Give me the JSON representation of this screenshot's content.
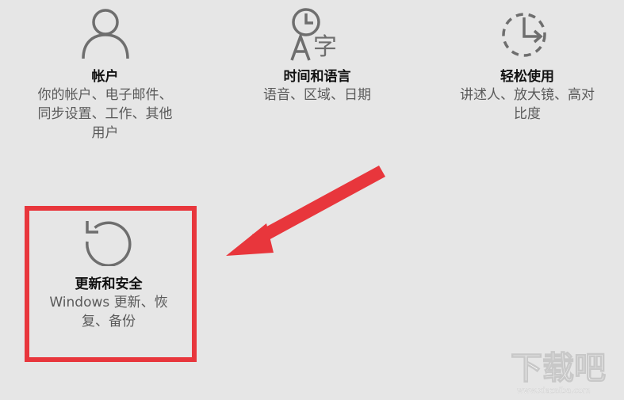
{
  "tiles": {
    "accounts": {
      "icon": "person-icon",
      "title": "帐户",
      "desc_lines": [
        "你的帐户、电子邮件、",
        "同步设置、工作、其他",
        "用户"
      ]
    },
    "time_language": {
      "icon": "time-language-icon",
      "title": "时间和语言",
      "desc_lines": [
        "语音、区域、日期"
      ]
    },
    "ease_of_access": {
      "icon": "ease-of-access-icon",
      "title": "轻松使用",
      "desc_lines": [
        "讲述人、放大镜、高对",
        "比度"
      ]
    },
    "update_security": {
      "icon": "refresh-icon",
      "title": "更新和安全",
      "desc_lines": [
        "Windows 更新、恢",
        "复、备份"
      ]
    }
  },
  "annotations": {
    "highlight_color": "#e8363c",
    "arrow_color": "#e8363c"
  },
  "watermark": {
    "logo_text": "下载吧",
    "url_text": "www.xiazaiba.com"
  },
  "colors": {
    "background": "#e6e6e6",
    "icon": "#6e6e6e",
    "title": "#111111",
    "description": "#5a5a5a"
  }
}
